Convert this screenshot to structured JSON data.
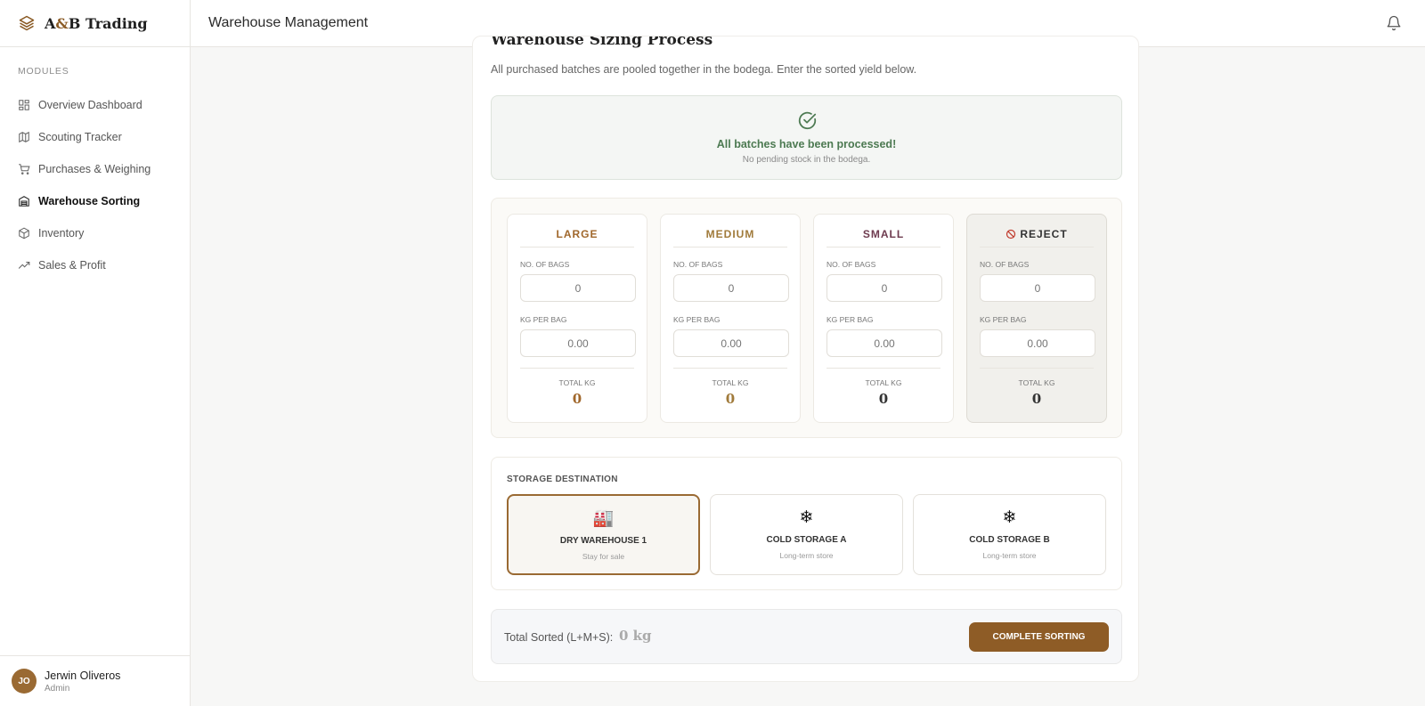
{
  "brand": {
    "name_prefix": "A",
    "name_amp": "&",
    "name_suffix": "B Trading"
  },
  "sidebar": {
    "section_label": "MODULES",
    "items": [
      {
        "label": "Overview Dashboard",
        "icon": "grid-icon",
        "active": false
      },
      {
        "label": "Scouting Tracker",
        "icon": "map-icon",
        "active": false
      },
      {
        "label": "Purchases & Weighing",
        "icon": "cart-icon",
        "active": false
      },
      {
        "label": "Warehouse Sorting",
        "icon": "warehouse-icon",
        "active": true
      },
      {
        "label": "Inventory",
        "icon": "box-icon",
        "active": false
      },
      {
        "label": "Sales & Profit",
        "icon": "trending-up-icon",
        "active": false
      }
    ],
    "user": {
      "initials": "JO",
      "name": "Jerwin Oliveros",
      "role": "Admin"
    }
  },
  "header": {
    "title": "Warehouse Management"
  },
  "process": {
    "title": "Warehouse Sizing Process",
    "subtitle": "All purchased batches are pooled together in the bodega. Enter the sorted yield below.",
    "status_title": "All batches have been processed!",
    "status_sub": "No pending stock in the bodega."
  },
  "sizes": [
    {
      "name": "LARGE",
      "color": "#a0672b",
      "bags_label": "NO. OF BAGS",
      "bags_placeholder": "0",
      "kg_label": "KG PER BAG",
      "kg_placeholder": "0.00",
      "total_label": "TOTAL KG",
      "total": "0"
    },
    {
      "name": "MEDIUM",
      "color": "#a07a3a",
      "bags_label": "NO. OF BAGS",
      "bags_placeholder": "0",
      "kg_label": "KG PER BAG",
      "kg_placeholder": "0.00",
      "total_label": "TOTAL KG",
      "total": "0"
    },
    {
      "name": "SMALL",
      "color": "#6e3b4f",
      "bags_label": "NO. OF BAGS",
      "bags_placeholder": "0",
      "kg_label": "KG PER BAG",
      "kg_placeholder": "0.00",
      "total_label": "TOTAL KG",
      "total": "0"
    },
    {
      "name": "REJECT",
      "color": "#333333",
      "bags_label": "NO. OF BAGS",
      "bags_placeholder": "0",
      "kg_label": "KG PER BAG",
      "kg_placeholder": "0.00",
      "total_label": "TOTAL KG",
      "total": "0"
    }
  ],
  "storage": {
    "label": "STORAGE DESTINATION",
    "options": [
      {
        "icon": "🏭",
        "name": "DRY WAREHOUSE 1",
        "sub": "Stay for sale",
        "selected": true
      },
      {
        "icon": "❄",
        "name": "COLD STORAGE A",
        "sub": "Long-term store",
        "selected": false
      },
      {
        "icon": "❄",
        "name": "COLD STORAGE B",
        "sub": "Long-term store",
        "selected": false
      }
    ]
  },
  "footer": {
    "sorted_label": "Total Sorted (L+M+S):",
    "sorted_value": "0 kg",
    "complete_label": "COMPLETE SORTING"
  },
  "colors": {
    "accent": "#8e5c26",
    "success": "#4d7a52"
  }
}
